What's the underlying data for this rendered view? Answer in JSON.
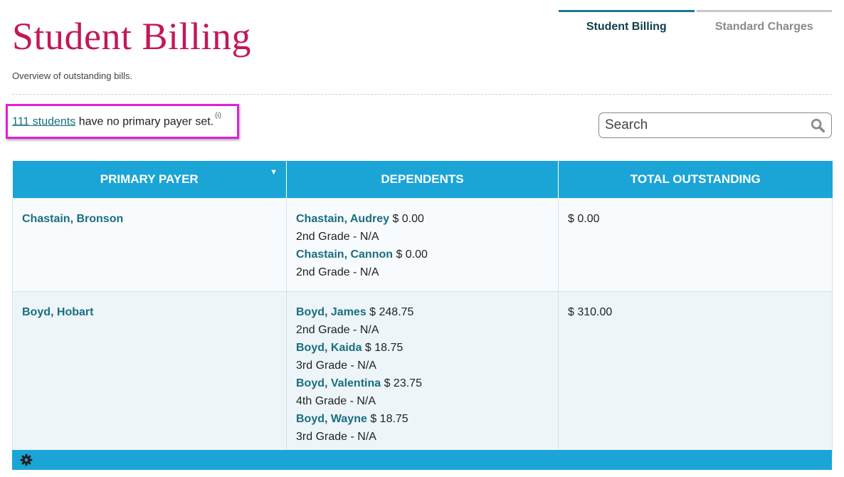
{
  "header": {
    "title": "Student Billing",
    "subtitle": "Overview of outstanding bills."
  },
  "tabs": [
    {
      "label": "Student Billing",
      "active": true
    },
    {
      "label": "Standard Charges",
      "active": false
    }
  ],
  "notice": {
    "link_text": "111 students",
    "text": " have no primary payer set.",
    "info_marker": "(i)"
  },
  "search": {
    "placeholder": "Search",
    "icon": "search-icon"
  },
  "table": {
    "columns": [
      "PRIMARY PAYER",
      "DEPENDENTS",
      "TOTAL OUTSTANDING"
    ],
    "sort_icon": "sort-down-icon",
    "rows": [
      {
        "payer": "Chastain, Bronson",
        "dependents": [
          {
            "name": "Chastain, Audrey",
            "amount": " $ 0.00",
            "grade": "2nd Grade - N/A"
          },
          {
            "name": "Chastain, Cannon",
            "amount": " $ 0.00",
            "grade": "2nd Grade - N/A"
          }
        ],
        "total": "$ 0.00"
      },
      {
        "payer": "Boyd, Hobart",
        "dependents": [
          {
            "name": "Boyd, James",
            "amount": " $ 248.75",
            "grade": "2nd Grade - N/A"
          },
          {
            "name": "Boyd, Kaida",
            "amount": " $ 18.75",
            "grade": "3rd Grade - N/A"
          },
          {
            "name": "Boyd, Valentina",
            "amount": " $ 23.75",
            "grade": "4th Grade - N/A"
          },
          {
            "name": "Boyd, Wayne",
            "amount": " $ 18.75",
            "grade": "3rd Grade - N/A"
          }
        ],
        "total": "$ 310.00"
      }
    ]
  },
  "footer": {
    "icon": "gear-icon"
  },
  "colors": {
    "title": "#c2185b",
    "accent": "#1aa5d6",
    "link": "#1a6e80",
    "highlight": "#e020d8"
  }
}
